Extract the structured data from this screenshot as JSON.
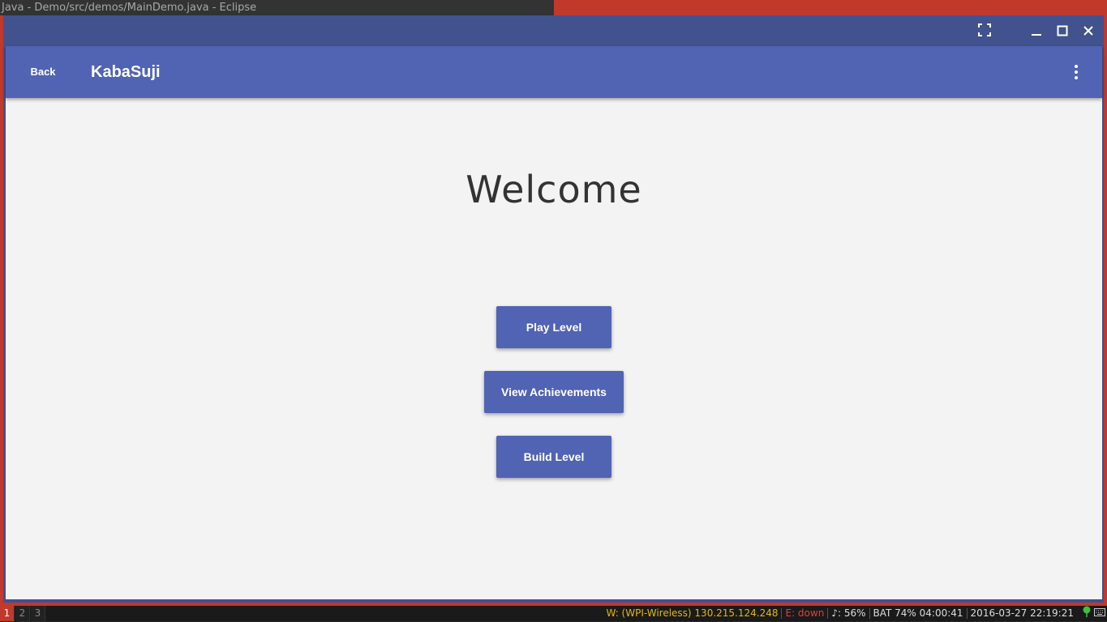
{
  "wm": {
    "window_title": "Java - Demo/src/demos/MainDemo.java - Eclipse"
  },
  "window_controls": {
    "fullscreen_icon": "fullscreen-icon",
    "minimize_icon": "minimize-icon",
    "maximize_icon": "maximize-icon",
    "close_icon": "close-icon"
  },
  "toolbar": {
    "back_label": "Back",
    "title": "KabaSuji",
    "more_icon": "more-vert-icon"
  },
  "main": {
    "heading": "Welcome",
    "buttons": {
      "play": "Play Level",
      "achievements": "View Achievements",
      "build": "Build Level"
    }
  },
  "statusbar": {
    "workspaces": [
      "1",
      "2",
      "3"
    ],
    "active_workspace": "1",
    "wifi": "W: (WPI-Wireless) 130.215.124.248",
    "ethernet": "E: down",
    "volume": "♪: 56%",
    "battery": "BAT 74% 04:00:41",
    "datetime": "2016-03-27 22:19:21"
  },
  "colors": {
    "accent": "#5163b3",
    "frame": "#c0392b",
    "content_bg": "#f3f3f3"
  }
}
